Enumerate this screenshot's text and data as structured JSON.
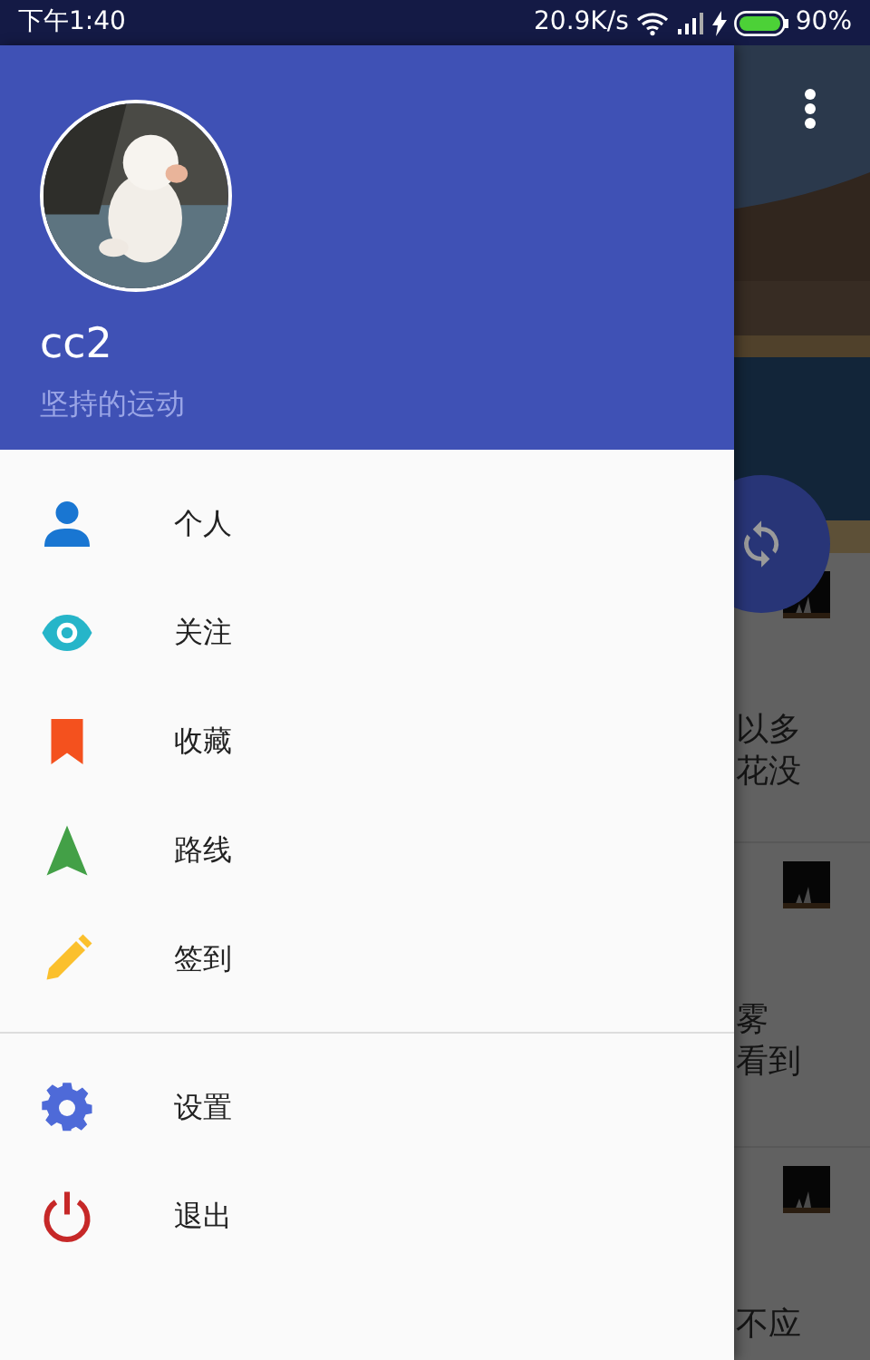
{
  "status_bar": {
    "time": "下午1:40",
    "net_speed": "20.9K/s",
    "battery": "90%"
  },
  "background": {
    "snippets": [
      {
        "lines": [
          "以多",
          "花没"
        ]
      },
      {
        "lines": [
          "雾",
          "看到"
        ]
      },
      {
        "lines": [
          "不应"
        ]
      }
    ]
  },
  "drawer": {
    "header": {
      "name": "cc2",
      "motto": "坚持的运动"
    },
    "sections": [
      [
        {
          "kind": "person",
          "label": "个人"
        },
        {
          "kind": "eye",
          "label": "关注"
        },
        {
          "kind": "bookmark",
          "label": "收藏"
        },
        {
          "kind": "navigation",
          "label": "路线"
        },
        {
          "kind": "pencil",
          "label": "签到"
        }
      ],
      [
        {
          "kind": "gear",
          "label": "设置"
        },
        {
          "kind": "power",
          "label": "退出"
        }
      ]
    ]
  }
}
